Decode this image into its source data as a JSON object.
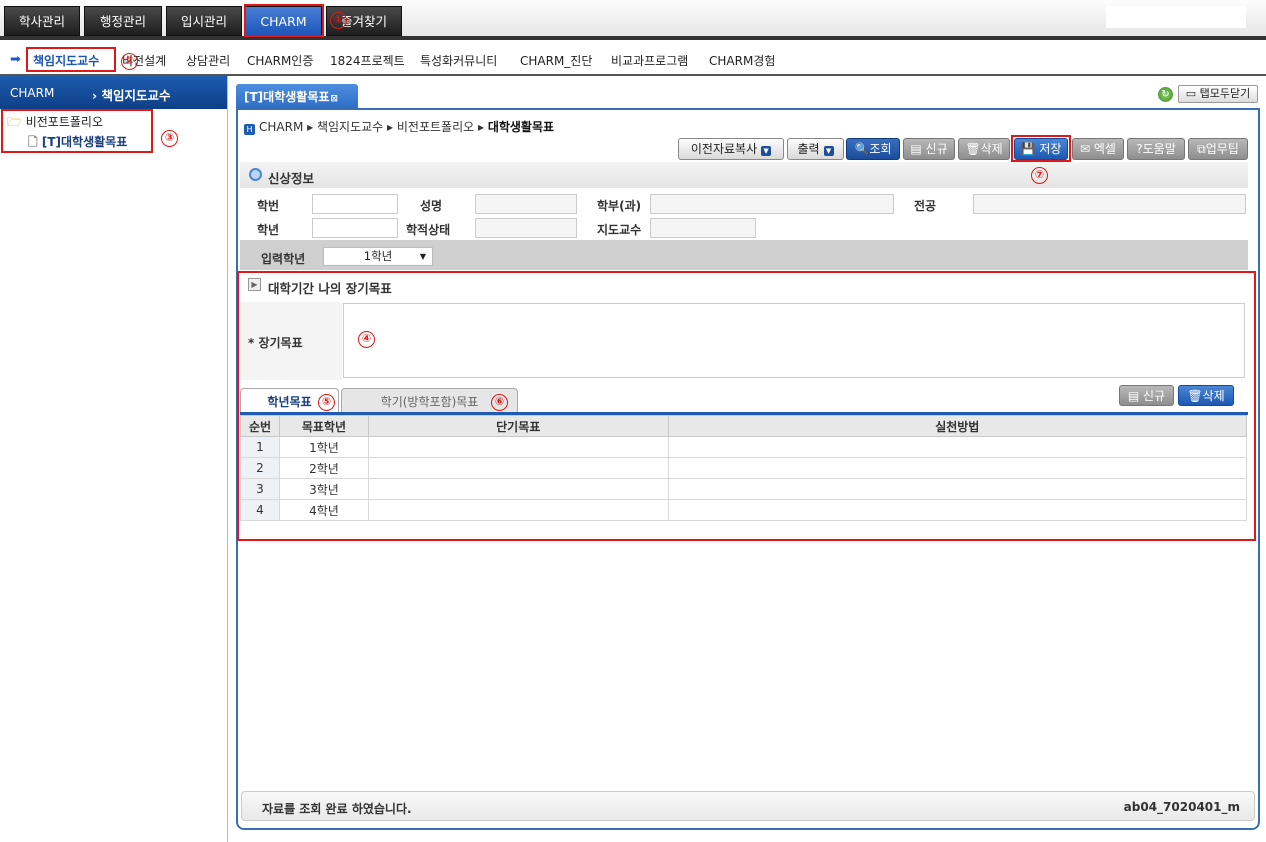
{
  "top_tabs": [
    "학사관리",
    "행정관리",
    "입시관리",
    "CHARM",
    "즐겨찾기"
  ],
  "sub_menu": [
    "책임지도교수",
    "비전설계",
    "상담관리",
    "CHARM인증",
    "1824프로젝트",
    "특성화커뮤니티",
    "CHARM_진단",
    "비교과프로그램",
    "CHARM경험"
  ],
  "left_panel": {
    "header_left": "CHARM",
    "header_right": "책임지도교수",
    "tree_folder": "비전포트폴리오",
    "tree_item": "[T]대학생활목표"
  },
  "main_tab": {
    "label": "[T]대학생활목표",
    "close_all": "탭모두닫기"
  },
  "breadcrumb": {
    "items": [
      "CHARM",
      "책임지도교수",
      "비전포트폴리오"
    ],
    "current": "대학생활목표"
  },
  "toolbar": {
    "copy_prev": "이전자료복사",
    "print": "출력",
    "search": "조회",
    "new": "신규",
    "delete": "삭제",
    "save": "저장",
    "excel": "엑셀",
    "help": "도움말",
    "tip": "업무팁"
  },
  "profile": {
    "title": "신상정보",
    "labels": {
      "student_id": "학번",
      "name": "성명",
      "dept": "학부(과)",
      "major": "전공",
      "year": "학년",
      "status": "학적상태",
      "advisor": "지도교수"
    },
    "grade_label": "입력학년",
    "grade_value": "1학년"
  },
  "long_goal": {
    "title": "대학기간 나의 장기목표",
    "label": "* 장기목표"
  },
  "sub_tabs": [
    "학년목표",
    "학기(방학포함)목표"
  ],
  "grid_buttons": {
    "new": "신규",
    "delete": "삭제"
  },
  "grid": {
    "headers": [
      "순번",
      "목표학년",
      "단기목표",
      "실천방법"
    ],
    "rows": [
      [
        "1",
        "1학년",
        "",
        ""
      ],
      [
        "2",
        "2학년",
        "",
        ""
      ],
      [
        "3",
        "3학년",
        "",
        ""
      ],
      [
        "4",
        "4학년",
        "",
        ""
      ]
    ]
  },
  "status_bar": {
    "message": "자료를 조회 완료 하였습니다.",
    "code": "ab04_7020401_m"
  },
  "annotations": [
    "①",
    "②",
    "③",
    "④",
    "⑤",
    "⑥",
    "⑦"
  ],
  "colors": {
    "accent_blue": "#1d5cb0",
    "annotation_red": "#e01818"
  }
}
